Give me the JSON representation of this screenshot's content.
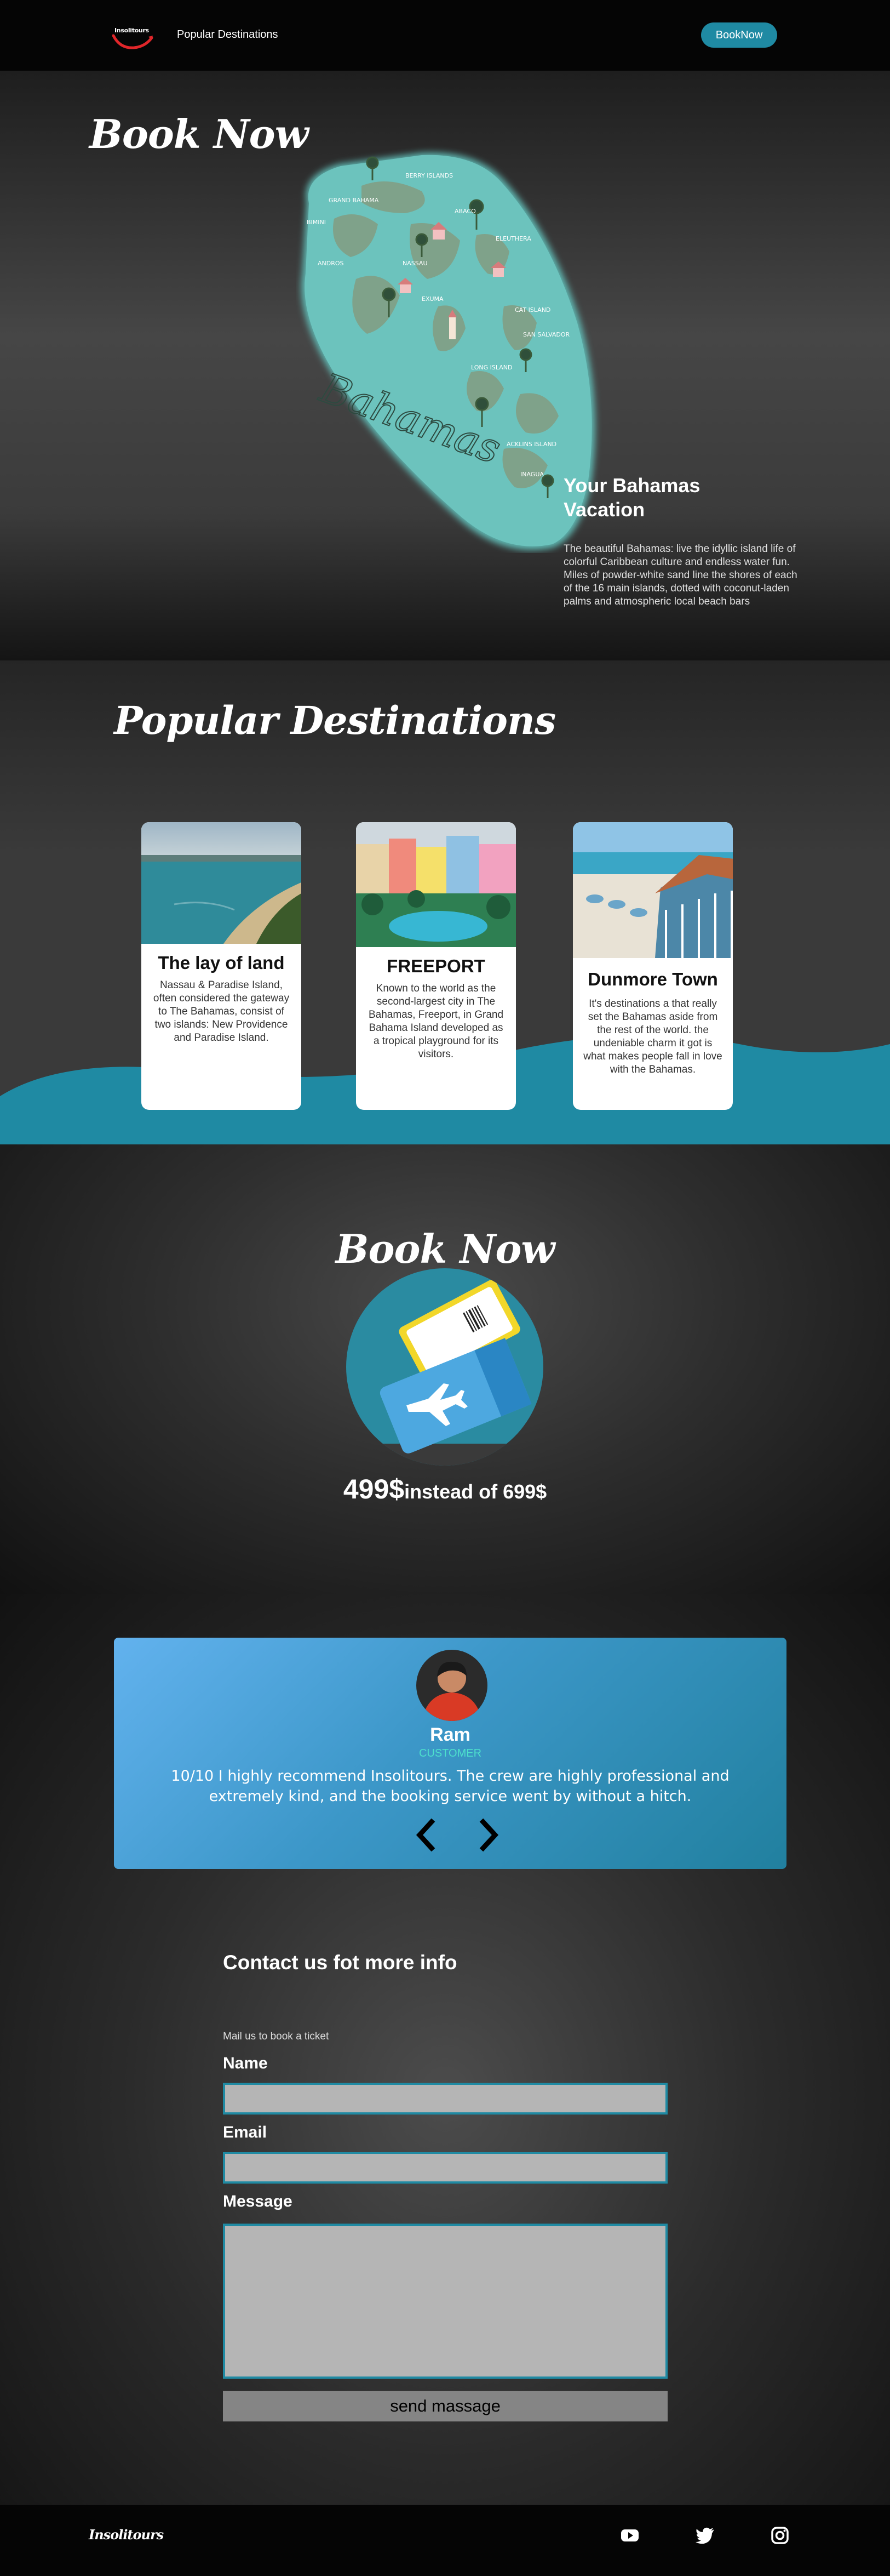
{
  "nav": {
    "logo_text": "Insolitours",
    "link_label": "Popular Destinations",
    "button_label": "BookNow"
  },
  "hero": {
    "title": "Book Now",
    "subtitle": "Your Bahamas Vacation",
    "description": "The beautiful Bahamas: live the idyllic island life of colorful Caribbean culture and endless water fun. Miles of powder-white sand line the shores of each of the 16 main islands, dotted with coconut-laden palms and atmospheric local beach bars",
    "map_title": "Bahamas",
    "map_labels": [
      "BERRY ISLANDS",
      "GRAND BAHAMA",
      "ABACO",
      "BIMINI",
      "ANDROS",
      "NASSAU",
      "ELEUTHERA",
      "SAN SALVADOR",
      "CAT ISLAND",
      "EXUMA",
      "LONG ISLAND",
      "ACKLINS ISLAND",
      "INAGUA"
    ]
  },
  "destinations": {
    "title": "Popular Destinations",
    "cards": [
      {
        "title": "The lay of land",
        "text": "Nassau & Paradise Island, often considered the gateway to The Bahamas, consist of two islands: New Providence and Paradise Island."
      },
      {
        "title": "FREEPORT",
        "text": "Known to the world as the second-largest city in The Bahamas, Freeport, in Grand Bahama Island developed as a tropical playground for its visitors."
      },
      {
        "title": "Dunmore Town",
        "text": "It's destinations a that really set the Bahamas aside from the rest of the world. the undeniable charm it got is what makes people fall in love with the Bahamas."
      }
    ]
  },
  "booking": {
    "title": "Book Now",
    "price": "499$",
    "old_price": "instead of 699$"
  },
  "testimonial": {
    "name": "Ram",
    "role": "CUSTOMER",
    "quote": "10/10 I highly recommend Insolitours. The crew are highly professional and extremely kind, and the booking service went by without a hitch."
  },
  "contact": {
    "title": "Contact us fot more info",
    "subtitle": "Mail us to book a ticket",
    "name_label": "Name",
    "email_label": "Email",
    "message_label": "Message",
    "send_label": "send massage"
  },
  "footer": {
    "brand": "Insolitours",
    "icons": [
      "youtube-icon",
      "twitter-icon",
      "instagram-icon"
    ]
  },
  "colors": {
    "accent": "#1f8aa3",
    "nav_bg": "#050505",
    "map_sea": "#6cc3bd",
    "testimonial_role": "#4de0cc"
  }
}
